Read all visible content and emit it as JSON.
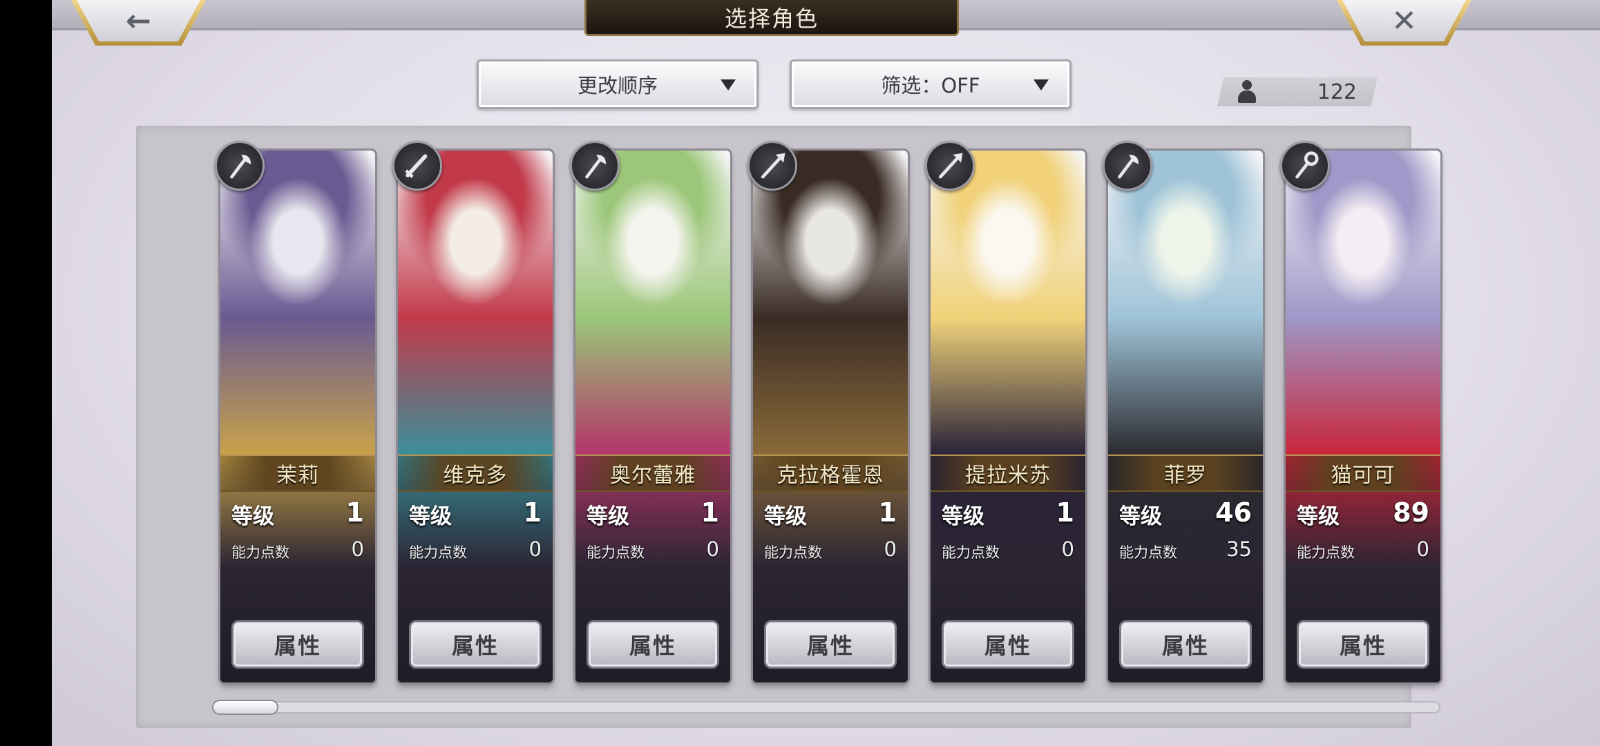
{
  "header": {
    "title": "选择角色",
    "back_icon": "←",
    "close_icon": "✕"
  },
  "controls": {
    "sort_label": "更改顺序",
    "filter_label": "筛选：OFF",
    "character_count": "122"
  },
  "labels": {
    "level": "等级",
    "ability_points": "能力点数",
    "attribute_button": "属性"
  },
  "characters": [
    {
      "name": "茉莉",
      "level": "1",
      "points": "0",
      "weapon": "axe-icon",
      "palette": [
        "#e8e6ee",
        "#6a5a92",
        "#c9a24a"
      ]
    },
    {
      "name": "维克多",
      "level": "1",
      "points": "0",
      "weapon": "sword-icon",
      "palette": [
        "#f3ede6",
        "#c23a4a",
        "#3a8f9a"
      ]
    },
    {
      "name": "奥尔蕾雅",
      "level": "1",
      "points": "0",
      "weapon": "axe-icon",
      "palette": [
        "#f6f4ef",
        "#9cc77a",
        "#b3356a"
      ]
    },
    {
      "name": "克拉格霍恩",
      "level": "1",
      "points": "0",
      "weapon": "spear-icon",
      "palette": [
        "#e9e7e4",
        "#3a2c24",
        "#8a6a3a"
      ]
    },
    {
      "name": "提拉米苏",
      "level": "1",
      "points": "0",
      "weapon": "spear-icon",
      "palette": [
        "#fbf8f2",
        "#f1d27a",
        "#2a2338"
      ]
    },
    {
      "name": "菲罗",
      "level": "46",
      "points": "35",
      "weapon": "axe-icon",
      "palette": [
        "#eef4ea",
        "#9fc4d8",
        "#2b2b30"
      ]
    },
    {
      "name": "猫可可",
      "level": "89",
      "points": "0",
      "weapon": "staff-icon",
      "palette": [
        "#f4eef4",
        "#9f98c8",
        "#c8253a"
      ]
    }
  ]
}
